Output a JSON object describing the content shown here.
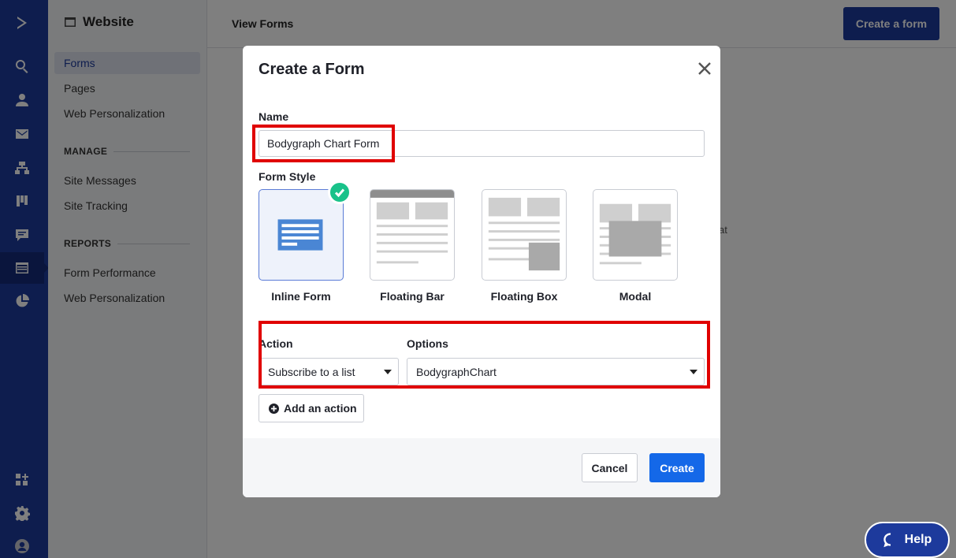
{
  "sidebar": {
    "header": "Website",
    "items": [
      "Forms",
      "Pages",
      "Web Personalization"
    ],
    "manage_heading": "MANAGE",
    "manage_items": [
      "Site Messages",
      "Site Tracking"
    ],
    "reports_heading": "REPORTS",
    "reports_items": [
      "Form Performance",
      "Web Personalization"
    ]
  },
  "topbar": {
    "title": "View Forms",
    "create_button": "Create a form"
  },
  "background": {
    "partial_text": "at"
  },
  "modal": {
    "title": "Create a Form",
    "name_label": "Name",
    "name_value": "Bodygraph Chart Form",
    "form_style_label": "Form Style",
    "styles": [
      "Inline Form",
      "Floating Bar",
      "Floating Box",
      "Modal"
    ],
    "selected_style": "Inline Form",
    "action_label": "Action",
    "action_value": "Subscribe to a list",
    "options_label": "Options",
    "options_value": "BodygraphChart",
    "add_action_button": "Add an action",
    "cancel_button": "Cancel",
    "create_button": "Create"
  },
  "help_button": "Help",
  "colors": {
    "brand_blue": "#1d3a9c",
    "primary_button": "#1468e8",
    "selected_check": "#19c28a",
    "highlight_red": "#e00000"
  }
}
